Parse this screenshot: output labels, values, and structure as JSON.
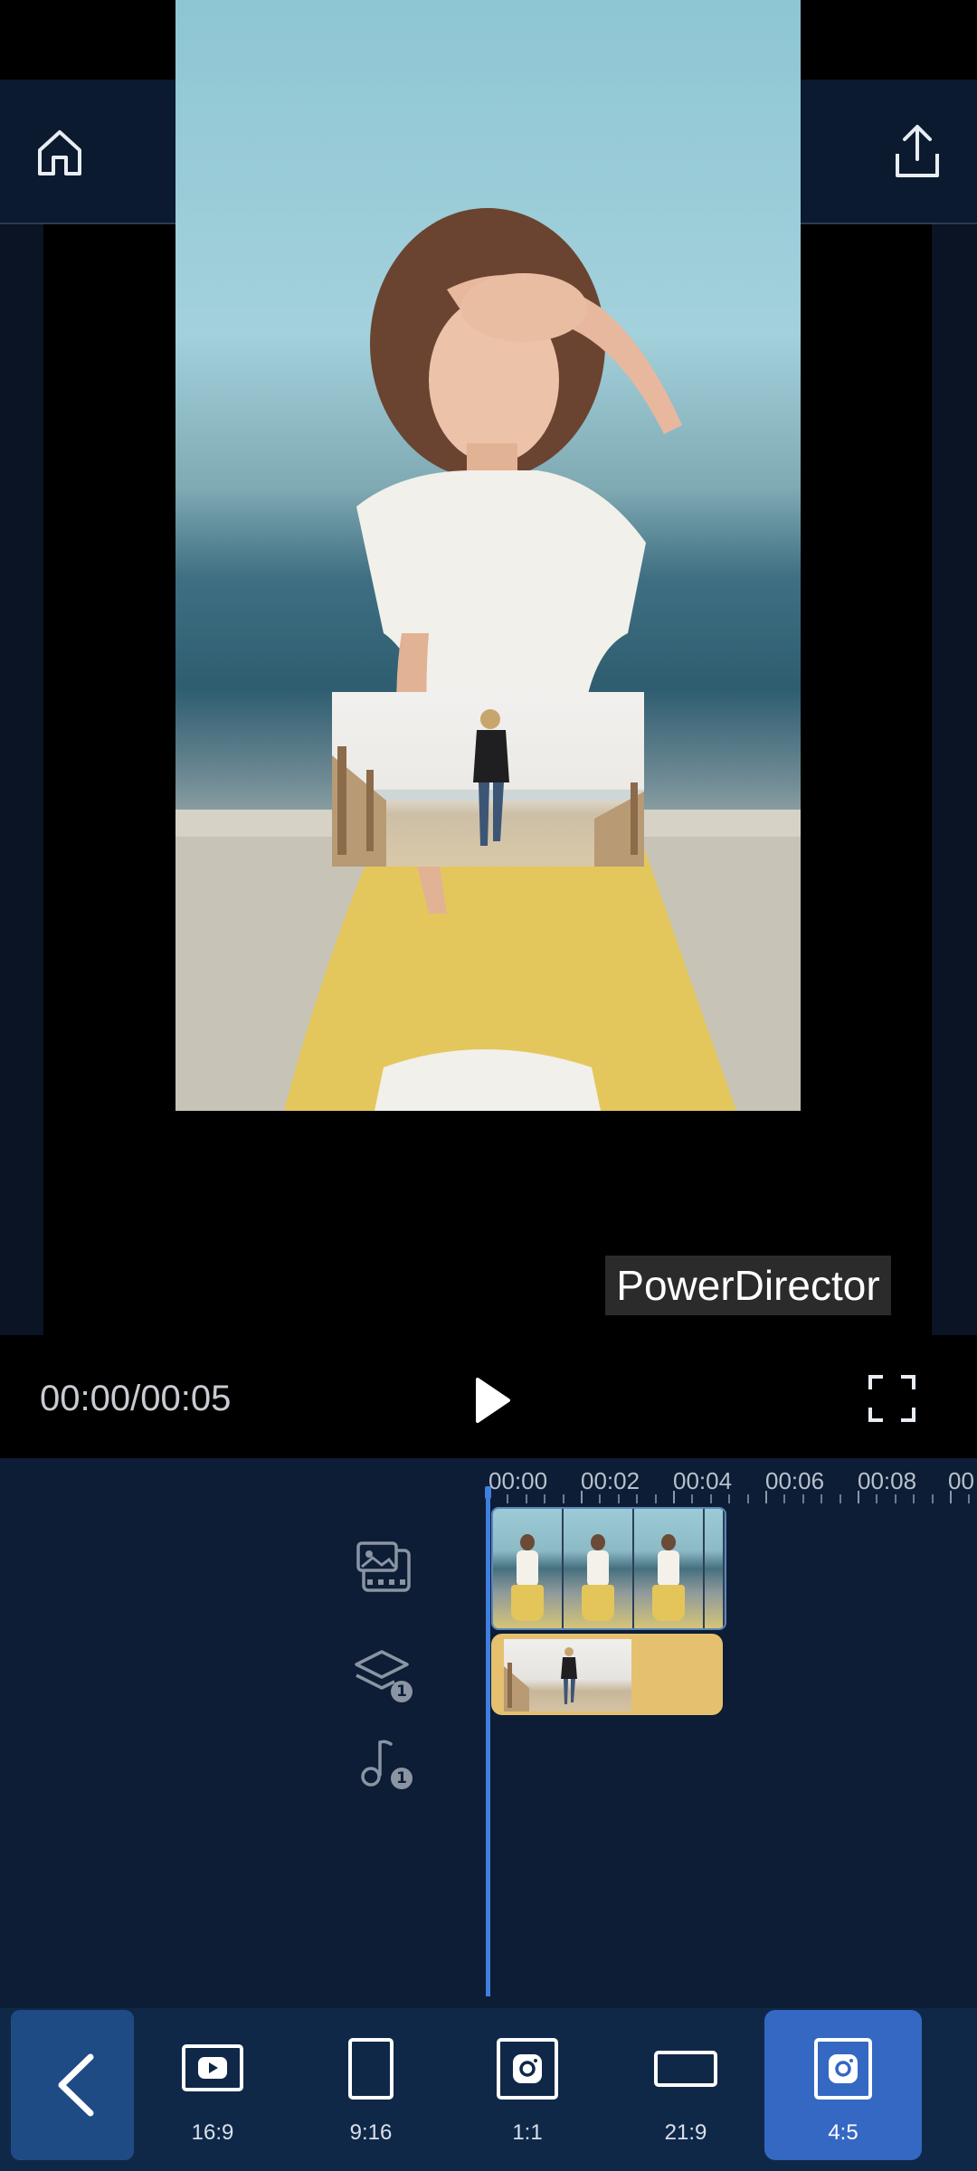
{
  "toolbar": {
    "home_icon": "home-icon",
    "undo_icon": "undo-icon",
    "redo_icon": "redo-icon",
    "more_icon": "more-icon",
    "share_icon": "share-icon",
    "redo_enabled": false
  },
  "preview": {
    "watermark": "PowerDirector"
  },
  "playback": {
    "time": "00:00/00:05",
    "play_icon": "play-icon",
    "fullscreen_icon": "fullscreen-icon"
  },
  "timeline": {
    "ruler": [
      "00:00",
      "00:02",
      "00:04",
      "00:06",
      "00:08",
      "00"
    ],
    "tracks": [
      {
        "icon": "video-track-icon",
        "badge": ""
      },
      {
        "icon": "layers-icon",
        "badge": "1"
      },
      {
        "icon": "music-note-icon",
        "badge": "1"
      }
    ]
  },
  "aspect_ratios": {
    "back_icon": "chevron-left-icon",
    "options": [
      {
        "label": "16:9",
        "icon": "youtube-icon"
      },
      {
        "label": "9:16",
        "icon": "portrait-rect-icon"
      },
      {
        "label": "1:1",
        "icon": "instagram-icon"
      },
      {
        "label": "21:9",
        "icon": "wide-rect-icon"
      },
      {
        "label": "4:5",
        "icon": "instagram-icon"
      }
    ],
    "selected": "4:5"
  },
  "colors": {
    "accent": "#3568c3",
    "playhead": "#3f7fe0",
    "overlay_clip": "#e5c06f",
    "background": "#0c1d35"
  }
}
